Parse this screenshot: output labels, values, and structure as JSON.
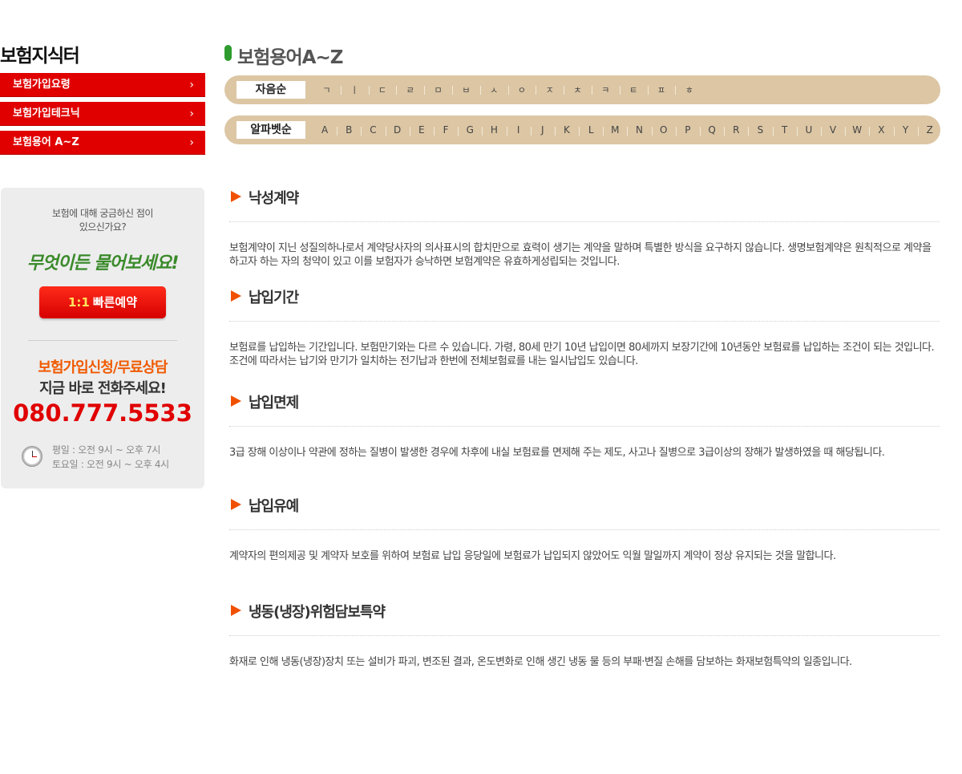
{
  "sidebar": {
    "title": "보험지식터",
    "menu": [
      {
        "label": "보험가입요령"
      },
      {
        "label": "보험가입테크닉"
      },
      {
        "label": "보험용어 A~Z"
      }
    ],
    "chevron": "›",
    "cs": {
      "question_line1": "보험에 대해 궁금하신 점이",
      "question_line2": "있으신가요?",
      "handwriting": "무엇이든 물어보세요!",
      "quick_num": "1:1",
      "quick_label": "빠른예약",
      "apply": "보험가입신청/무료상담",
      "call": "지금 바로 전화주세요!",
      "phone": "080.777.5533",
      "hours_weekday": "평일 : 오전 9시 ~ 오후 7시",
      "hours_saturday": "토요일 : 오전 9시 ~ 오후 4시"
    }
  },
  "main": {
    "title": "보험용어A~Z",
    "consonant_label": "자음순",
    "consonants": [
      "ㄱ",
      "ㅣ",
      "ㄷ",
      "ㄹ",
      "ㅁ",
      "ㅂ",
      "ㅅ",
      "ㅇ",
      "ㅈ",
      "ㅊ",
      "ㅋ",
      "ㅌ",
      "ㅍ",
      "ㅎ"
    ],
    "alpha_label": "알파벳순",
    "alphabet": [
      "A",
      "B",
      "C",
      "D",
      "E",
      "F",
      "G",
      "H",
      "I",
      "J",
      "K",
      "L",
      "M",
      "N",
      "O",
      "P",
      "Q",
      "R",
      "S",
      "T",
      "U",
      "V",
      "W",
      "X",
      "Y",
      "Z"
    ],
    "terms": [
      {
        "title": "낙성계약",
        "desc": "보험계약이 지닌 성질의하나로서 계약당사자의 의사표시의 합치만으로 효력이 생기는 계약을 말하며 특별한 방식을 요구하지 않습니다. 생명보험계약은 원칙적으로 계약을 하고자 하는 자의 청약이 있고 이를 보험자가 승낙하면 보험계약은 유효하게성립되는 것입니다."
      },
      {
        "title": "납입기간",
        "desc": "보험료를 납입하는 기간입니다. 보험만기와는 다르 수 있습니다. 가령, 80세 만기 10년 납입이면 80세까지 보장기간에 10년동안 보험료를 납입하는 조건이 되는 것입니다. 조건에 따라서는 납기와 만기가 일치하는 전기납과 한번에 전체보험료를 내는 일시납입도 있습니다."
      },
      {
        "title": "납입면제",
        "desc": "3급 장해 이상이나 약관에 정하는 질병이 발생한 경우에 차후에 내실 보험료를 면제해 주는 제도, 사고나 질병으로 3급이상의 장해가 발생하였을 때 해당됩니다."
      },
      {
        "title": "납입유예",
        "desc": "계약자의 편의제공 및 계약자 보호를 위하여 보험료 납입 응당일에 보험료가 납입되지 않았어도 익월 말일까지 계약이 정상 유지되는 것을 말합니다."
      },
      {
        "title": "냉동(냉장)위험담보특약",
        "desc": "화재로 인해 냉동(냉장)장치 또는 설비가 파괴, 변조된 결과, 온도변화로 인해 생긴 냉동 물 등의 부패·변질 손해를 담보하는 화재보험특약의 일종입니다."
      }
    ]
  },
  "colors": {
    "menu_red": "#e00000",
    "index_bar": "#dcc6a4",
    "title_accent_green": "#2e9b2e",
    "term_arrow_orange": "#f05000",
    "phone_red": "#e00000",
    "apply_orange": "#f05a00"
  }
}
